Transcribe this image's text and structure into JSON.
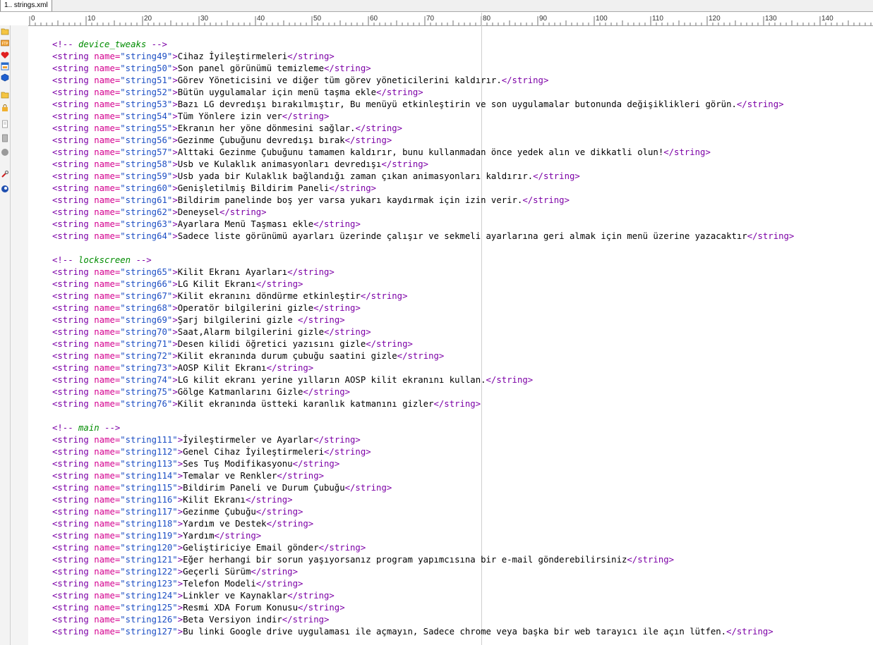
{
  "tab": {
    "label": "1.. strings.xml"
  },
  "ruler": {
    "labels": [
      "0",
      "10",
      "20",
      "30",
      "40",
      "50",
      "60",
      "70",
      "80",
      "90",
      "100",
      "110",
      "120",
      "130",
      "140"
    ]
  },
  "sidebar": {
    "icons": [
      "folder-icon",
      "ftp-icon",
      "favorites-heart-icon",
      "window-icon",
      "blue-cube-icon",
      "folder-icon",
      "lock-icon",
      "document-icon",
      "document-icon",
      "gray-circle-icon",
      "tools-icon",
      "blue-circle-icon"
    ]
  },
  "code": [
    {
      "type": "comment",
      "text": "device_tweaks"
    },
    {
      "type": "string",
      "name": "string49",
      "value": "Cihaz İyileştirmeleri"
    },
    {
      "type": "string",
      "name": "string50",
      "value": "Son panel görünümü temizleme"
    },
    {
      "type": "string",
      "name": "string51",
      "value": "Görev Yöneticisini ve diğer tüm görev yöneticilerini kaldırır."
    },
    {
      "type": "string",
      "name": "string52",
      "value": "Bütün uygulamalar için menü taşma ekle"
    },
    {
      "type": "string",
      "name": "string53",
      "value": "Bazı LG devredışı bırakılmıştır, Bu menüyü etkinleştirin ve son uygulamalar butonunda değişiklikleri görün."
    },
    {
      "type": "string",
      "name": "string54",
      "value": "Tüm Yönlere izin ver"
    },
    {
      "type": "string",
      "name": "string55",
      "value": "Ekranın her yöne dönmesini sağlar."
    },
    {
      "type": "string",
      "name": "string56",
      "value": "Gezinme Çubuğunu devredışı bırak"
    },
    {
      "type": "string",
      "name": "string57",
      "value": "Alttaki Gezinme Çubuğunu tamamen kaldırır, bunu kullanmadan önce yedek alın ve dikkatli olun!"
    },
    {
      "type": "string",
      "name": "string58",
      "value": "Usb ve Kulaklık animasyonları devredışı"
    },
    {
      "type": "string",
      "name": "string59",
      "value": "Usb yada bir Kulaklık bağlandığı zaman çıkan animasyonları kaldırır."
    },
    {
      "type": "string",
      "name": "string60",
      "value": "Genişletilmiş Bildirim Paneli"
    },
    {
      "type": "string",
      "name": "string61",
      "value": "Bildirim panelinde boş yer varsa yukarı kaydırmak için izin verir."
    },
    {
      "type": "string",
      "name": "string62",
      "value": "Deneysel"
    },
    {
      "type": "string",
      "name": "string63",
      "value": "Ayarlara Menü Taşması ekle"
    },
    {
      "type": "string",
      "name": "string64",
      "value": "Sadece liste görünümü ayarları üzerinde çalışır ve sekmeli ayarlarına geri almak için menü üzerine yazacaktır"
    },
    {
      "type": "blank"
    },
    {
      "type": "comment",
      "text": "lockscreen"
    },
    {
      "type": "string",
      "name": "string65",
      "value": "Kilit Ekranı Ayarları"
    },
    {
      "type": "string",
      "name": "string66",
      "value": "LG Kilit Ekranı"
    },
    {
      "type": "string",
      "name": "string67",
      "value": "Kilit ekranını döndürme etkinleştir"
    },
    {
      "type": "string",
      "name": "string68",
      "value": "Operatör bilgilerini gizle"
    },
    {
      "type": "string",
      "name": "string69",
      "value": "Şarj bilgilerini gizle "
    },
    {
      "type": "string",
      "name": "string70",
      "value": "Saat,Alarm bilgilerini gizle"
    },
    {
      "type": "string",
      "name": "string71",
      "value": "Desen kilidi öğretici yazısını gizle"
    },
    {
      "type": "string",
      "name": "string72",
      "value": "Kilit ekranında durum çubuğu saatini gizle"
    },
    {
      "type": "string",
      "name": "string73",
      "value": "AOSP Kilit Ekranı"
    },
    {
      "type": "string",
      "name": "string74",
      "value": "LG kilit ekranı yerine yılların AOSP kilit ekranını kullan."
    },
    {
      "type": "string",
      "name": "string75",
      "value": "Gölge Katmanlarını Gizle"
    },
    {
      "type": "string",
      "name": "string76",
      "value": "Kilit ekranında üstteki karanlık katmanını gizler"
    },
    {
      "type": "blank"
    },
    {
      "type": "comment",
      "text": "main"
    },
    {
      "type": "string",
      "name": "string111",
      "value": "İyileştirmeler ve Ayarlar"
    },
    {
      "type": "string",
      "name": "string112",
      "value": "Genel Cihaz İyileştirmeleri"
    },
    {
      "type": "string",
      "name": "string113",
      "value": "Ses Tuş Modifikasyonu"
    },
    {
      "type": "string",
      "name": "string114",
      "value": "Temalar ve Renkler"
    },
    {
      "type": "string",
      "name": "string115",
      "value": "Bildirim Paneli ve Durum Çubuğu"
    },
    {
      "type": "string",
      "name": "string116",
      "value": "Kilit Ekranı"
    },
    {
      "type": "string",
      "name": "string117",
      "value": "Gezinme Çubuğu"
    },
    {
      "type": "string",
      "name": "string118",
      "value": "Yardım ve Destek"
    },
    {
      "type": "string",
      "name": "string119",
      "value": "Yardım"
    },
    {
      "type": "string",
      "name": "string120",
      "value": "Geliştiriciye Email gönder"
    },
    {
      "type": "string",
      "name": "string121",
      "value": "Eğer herhangi bir sorun yaşıyorsanız program yapımcısına bir e-mail gönderebilirsiniz"
    },
    {
      "type": "string",
      "name": "string122",
      "value": "Geçerli Sürüm"
    },
    {
      "type": "string",
      "name": "string123",
      "value": "Telefon Modeli"
    },
    {
      "type": "string",
      "name": "string124",
      "value": "Linkler ve Kaynaklar"
    },
    {
      "type": "string",
      "name": "string125",
      "value": "Resmi XDA Forum Konusu"
    },
    {
      "type": "string",
      "name": "string126",
      "value": "Beta Versiyon indir"
    },
    {
      "type": "string",
      "name": "string127",
      "value": "Bu linki Google drive uygulaması ile açmayın, Sadece chrome veya başka bir web tarayıcı ile açın lütfen."
    }
  ]
}
